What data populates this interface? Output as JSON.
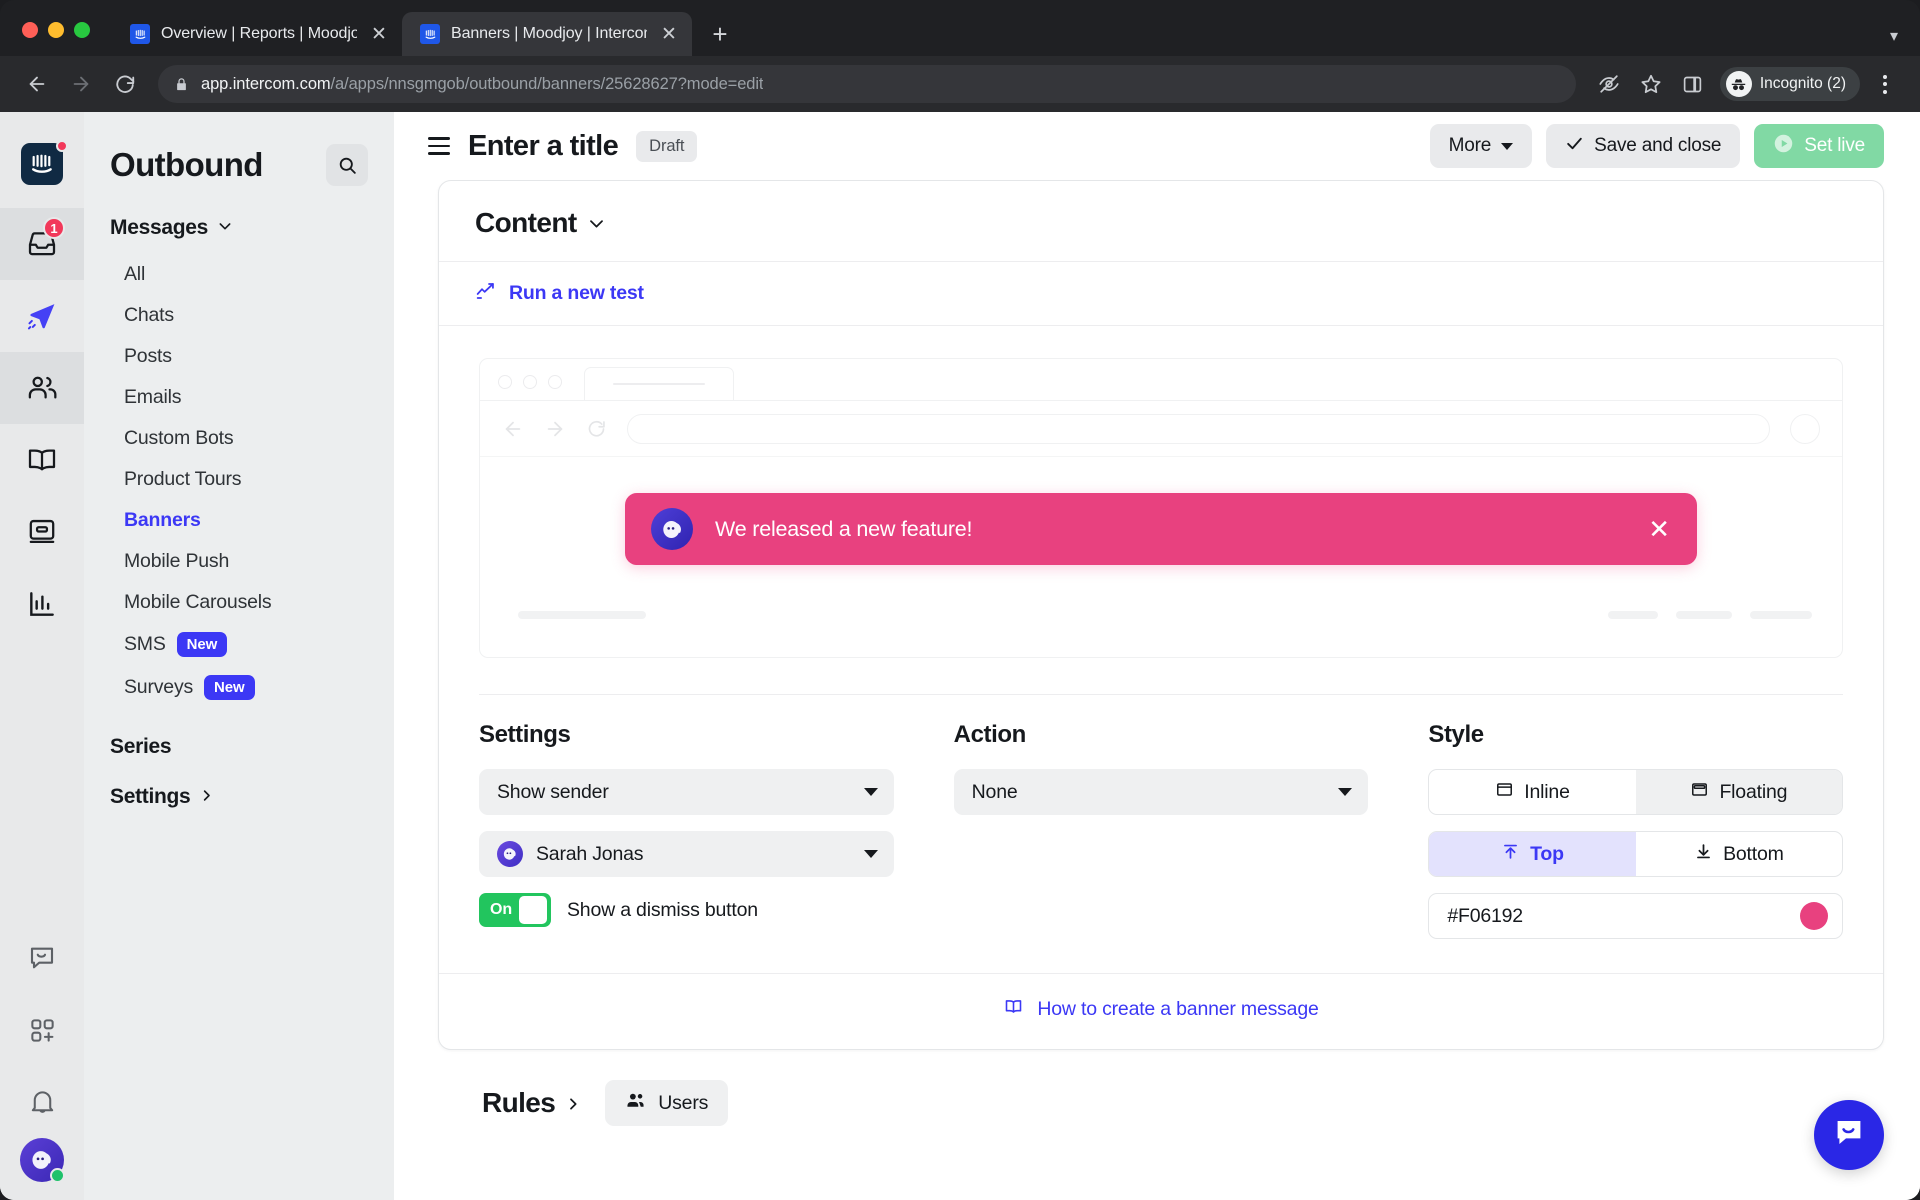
{
  "browser": {
    "tabs": [
      {
        "title": "Overview | Reports | Moodjoy |",
        "favicon": "intercom-favicon",
        "active": false
      },
      {
        "title": "Banners | Moodjoy | Intercom",
        "favicon": "intercom-favicon",
        "active": true
      }
    ],
    "new_tab_label": "+",
    "omnibox": {
      "host": "app.intercom.com",
      "path": "/a/apps/nnsgmgob/outbound/banners/25628627?mode=edit"
    },
    "profile_label": "Incognito (2)"
  },
  "rail": {
    "badge_count": "1",
    "items": [
      {
        "name": "intercom-logo"
      },
      {
        "name": "inbox-icon"
      },
      {
        "name": "outbound-icon"
      },
      {
        "name": "contacts-icon"
      },
      {
        "name": "articles-icon"
      },
      {
        "name": "news-icon"
      },
      {
        "name": "reports-icon"
      },
      {
        "name": "messenger-icon"
      },
      {
        "name": "apps-icon"
      },
      {
        "name": "notifications-icon"
      }
    ]
  },
  "sidebar": {
    "title": "Outbound",
    "search_icon": "search-icon",
    "group_label": "Messages",
    "items": [
      {
        "label": "All",
        "active": false,
        "badge": ""
      },
      {
        "label": "Chats",
        "active": false,
        "badge": ""
      },
      {
        "label": "Posts",
        "active": false,
        "badge": ""
      },
      {
        "label": "Emails",
        "active": false,
        "badge": ""
      },
      {
        "label": "Custom Bots",
        "active": false,
        "badge": ""
      },
      {
        "label": "Product Tours",
        "active": false,
        "badge": ""
      },
      {
        "label": "Banners",
        "active": true,
        "badge": ""
      },
      {
        "label": "Mobile Push",
        "active": false,
        "badge": ""
      },
      {
        "label": "Mobile Carousels",
        "active": false,
        "badge": ""
      },
      {
        "label": "SMS",
        "active": false,
        "badge": "New"
      },
      {
        "label": "Surveys",
        "active": false,
        "badge": "New"
      }
    ],
    "series_label": "Series",
    "settings_label": "Settings"
  },
  "header": {
    "menu_icon": "hamburger-icon",
    "title": "Enter a title",
    "status": "Draft",
    "more_label": "More",
    "save_label": "Save and close",
    "set_live_label": "Set live"
  },
  "content": {
    "section_title": "Content",
    "run_test_label": "Run a new test",
    "preview": {
      "banner_text": "We released a new feature!",
      "banner_color": "#E8417F",
      "dismiss_icon": "close-icon",
      "avatar_icon": "intercom-avatar"
    }
  },
  "settings": {
    "heading": "Settings",
    "sender_mode": "Show sender",
    "sender_name": "Sarah Jonas",
    "dismiss_toggle_state": "On",
    "dismiss_label": "Show a dismiss button"
  },
  "action": {
    "heading": "Action",
    "value": "None"
  },
  "style": {
    "heading": "Style",
    "layout_options": [
      {
        "label": "Inline",
        "selected": false
      },
      {
        "label": "Floating",
        "selected": true
      }
    ],
    "position_options": [
      {
        "label": "Top",
        "selected": true
      },
      {
        "label": "Bottom",
        "selected": false
      }
    ],
    "color_value": "#F06192",
    "color_swatch": "#E8417F"
  },
  "footer": {
    "help_link": "How to create a banner message",
    "help_icon": "book-icon"
  },
  "rules": {
    "heading": "Rules",
    "audience_label": "Users",
    "audience_icon": "users-icon"
  },
  "launcher": {
    "icon": "messenger-launcher-icon"
  }
}
